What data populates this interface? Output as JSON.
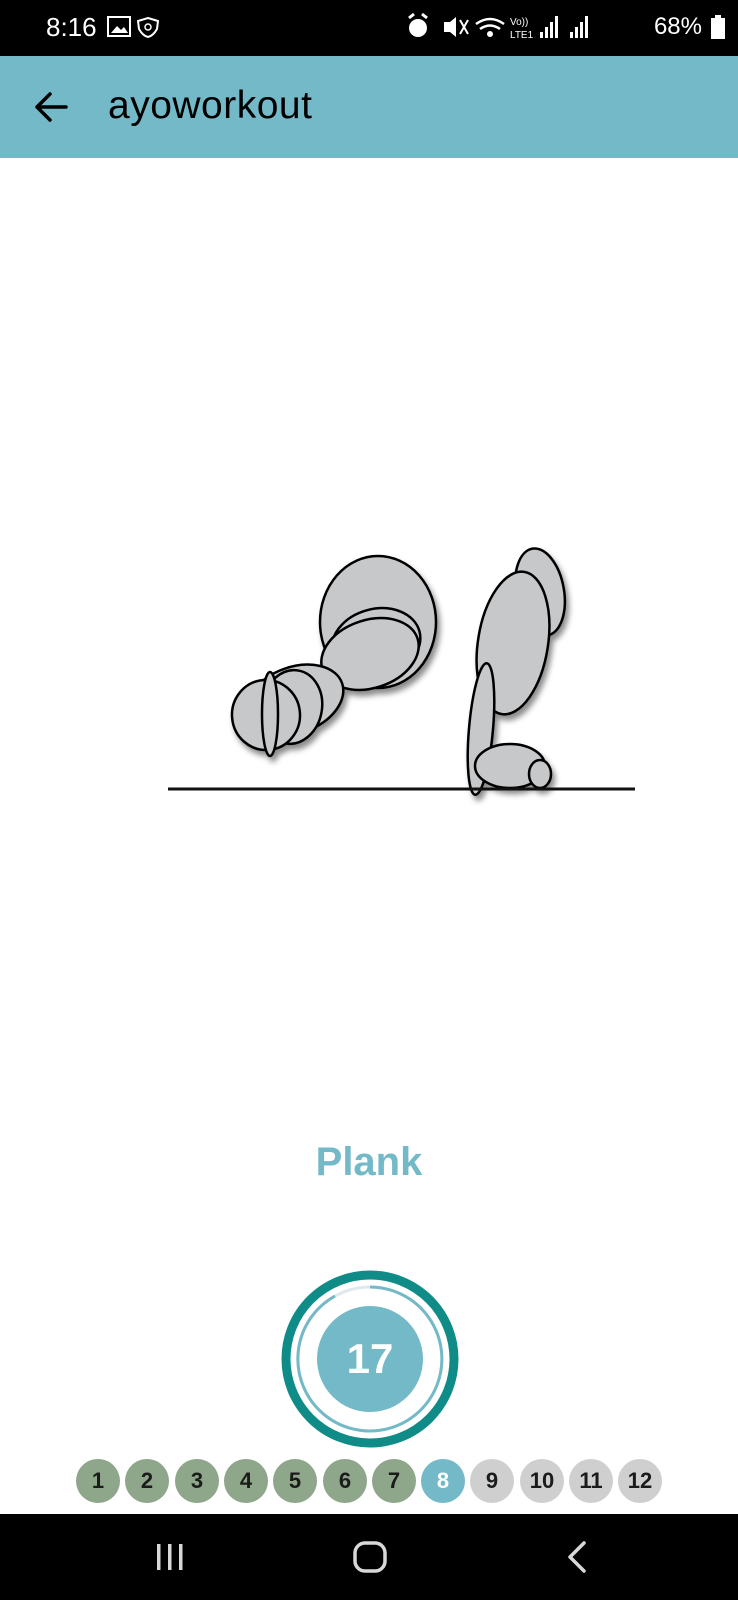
{
  "status_bar": {
    "time": "8:16",
    "battery": "68%"
  },
  "app_bar": {
    "title": "ayoworkout"
  },
  "exercise": {
    "name": "Plank"
  },
  "timer": {
    "value": "17"
  },
  "steps": [
    {
      "label": "1",
      "state": "done"
    },
    {
      "label": "2",
      "state": "done"
    },
    {
      "label": "3",
      "state": "done"
    },
    {
      "label": "4",
      "state": "done"
    },
    {
      "label": "5",
      "state": "done"
    },
    {
      "label": "6",
      "state": "done"
    },
    {
      "label": "7",
      "state": "done"
    },
    {
      "label": "8",
      "state": "current"
    },
    {
      "label": "9",
      "state": "todo"
    },
    {
      "label": "10",
      "state": "todo"
    },
    {
      "label": "11",
      "state": "todo"
    },
    {
      "label": "12",
      "state": "todo"
    }
  ],
  "colors": {
    "accent": "#74b9c8",
    "timer_ring": "#0f8c88",
    "done_step": "#8ea689",
    "todo_step": "#cfcfcf"
  },
  "icons": {
    "back": "arrow-back-icon",
    "recents": "recents-icon",
    "home": "home-icon",
    "nav_back": "nav-back-icon"
  }
}
